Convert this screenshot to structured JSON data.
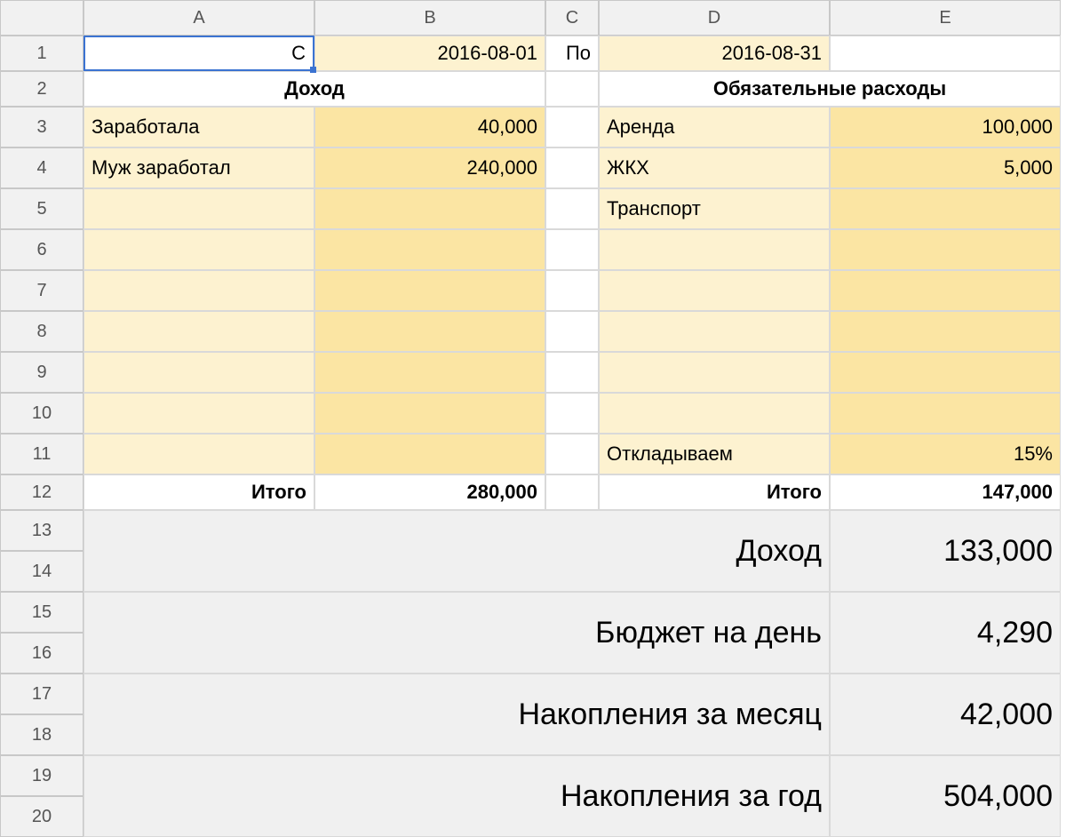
{
  "columns": [
    "A",
    "B",
    "C",
    "D",
    "E"
  ],
  "row_numbers": [
    "1",
    "2",
    "3",
    "4",
    "5",
    "6",
    "7",
    "8",
    "9",
    "10",
    "11",
    "12",
    "13",
    "14",
    "15",
    "16",
    "17",
    "18",
    "19",
    "20"
  ],
  "row1": {
    "a": "С",
    "b": "2016-08-01",
    "c": "По",
    "d": "2016-08-31"
  },
  "row2": {
    "income_header": "Доход",
    "expense_header": "Обязательные расходы"
  },
  "income": {
    "r3_label": "Заработала",
    "r3_val": "40,000",
    "r4_label": "Муж заработал",
    "r4_val": "240,000",
    "total_label": "Итого",
    "total_val": "280,000"
  },
  "expense": {
    "r3_label": "Аренда",
    "r3_val": "100,000",
    "r4_label": "ЖКХ",
    "r4_val": "5,000",
    "r5_label": "Транспорт",
    "r11_label": "Откладываем",
    "r11_val": "15%",
    "total_label": "Итого",
    "total_val": "147,000"
  },
  "summary": {
    "income_label": "Доход",
    "income_val": "133,000",
    "daily_label": "Бюджет на день",
    "daily_val": "4,290",
    "save_month_label": "Накопления за месяц",
    "save_month_val": "42,000",
    "save_year_label": "Накопления за год",
    "save_year_val": "504,000"
  }
}
